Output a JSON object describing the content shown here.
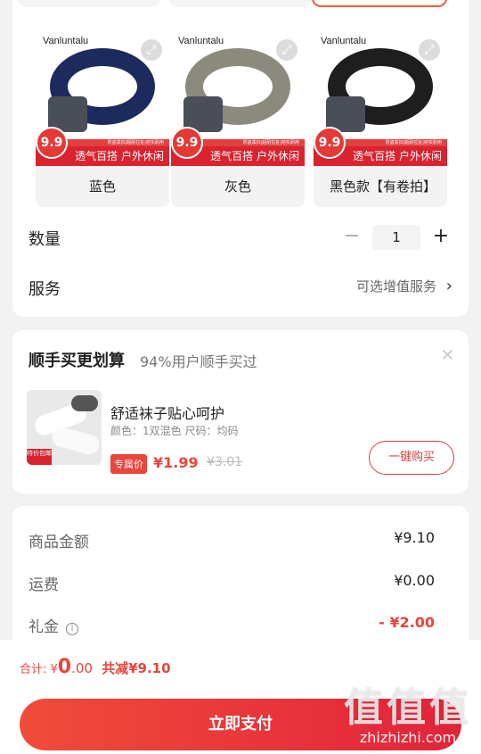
{
  "variants": [
    {
      "brand": "Vanluntalu",
      "label": "蓝色",
      "price_badge": "9.9",
      "promo": "透气百搭 户外休闲",
      "promo_small": "防盗黑扣|超耐拉扯|结实耐用",
      "color": "#1d2a5c"
    },
    {
      "brand": "Vanluntalu",
      "label": "灰色",
      "price_badge": "9.9",
      "promo": "透气百搭 户外休闲",
      "promo_small": "防盗黑扣|超耐拉扯|结实耐用",
      "color": "#8b8a7c"
    },
    {
      "brand": "Vanluntalu",
      "label": "黑色款【有卷拍】",
      "price_badge": "9.9",
      "promo": "透气百搭 户外休闲",
      "promo_small": "防盗黑扣|超耐拉扯|结实耐用",
      "color": "#1e1e1e"
    }
  ],
  "quantity": {
    "label": "数量",
    "value": "1",
    "minus": "−",
    "plus": "+"
  },
  "service": {
    "label": "服务",
    "value": "可选增值服务",
    "chevron": "›"
  },
  "bundle": {
    "title": "顺手买更划算",
    "subtitle": "94%用户顺手买过",
    "item_name": "舒适袜子贴心呵护",
    "item_spec": "颜色：1双混色   尺码：均码",
    "exclusive_tag": "专属价",
    "price": "¥1.99",
    "old_price": "¥3.01",
    "buy_button": "一键购买",
    "thumb_tag": "特价包邮"
  },
  "summary": {
    "rows": [
      {
        "label": "商品金额",
        "value": "¥9.10"
      },
      {
        "label": "运费",
        "value": "¥0.00"
      },
      {
        "label": "礼金",
        "value": "- ¥2.00"
      }
    ]
  },
  "footer": {
    "total_prefix": "合计: ¥",
    "total_int": "0",
    "total_dec": ".00",
    "discount": "共减¥9.10",
    "pay_button": "立即支付"
  },
  "watermark": {
    "big": "值值值",
    "small": "zhizhizhi.com"
  },
  "colors": {
    "accent": "#e8453c",
    "pay_start": "#f04c3a",
    "pay_end": "#e2233b"
  }
}
